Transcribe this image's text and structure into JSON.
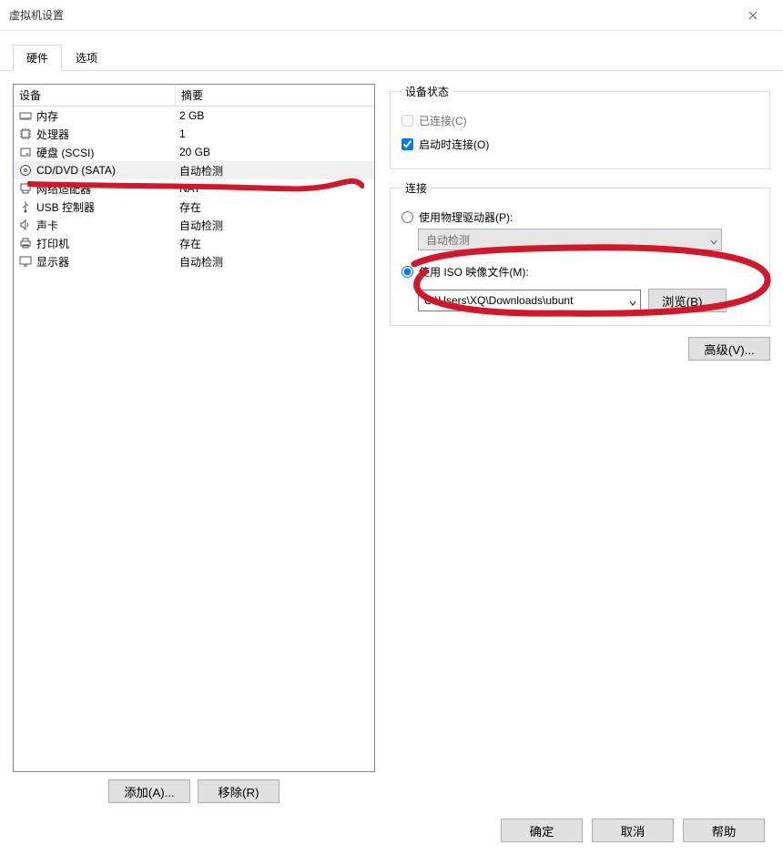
{
  "window": {
    "title": "虚拟机设置"
  },
  "tabs": {
    "hardware": "硬件",
    "options": "选项"
  },
  "device_list": {
    "headers": {
      "device": "设备",
      "summary": "摘要"
    },
    "items": [
      {
        "name": "内存",
        "summary": "2 GB",
        "icon": "memory"
      },
      {
        "name": "处理器",
        "summary": "1",
        "icon": "cpu"
      },
      {
        "name": "硬盘 (SCSI)",
        "summary": "20 GB",
        "icon": "disk"
      },
      {
        "name": "CD/DVD (SATA)",
        "summary": "自动检测",
        "icon": "cd",
        "selected": true
      },
      {
        "name": "网络适配器",
        "summary": "NAT",
        "icon": "net"
      },
      {
        "name": "USB 控制器",
        "summary": "存在",
        "icon": "usb"
      },
      {
        "name": "声卡",
        "summary": "自动检测",
        "icon": "sound"
      },
      {
        "name": "打印机",
        "summary": "存在",
        "icon": "printer"
      },
      {
        "name": "显示器",
        "summary": "自动检测",
        "icon": "display"
      }
    ]
  },
  "list_buttons": {
    "add": "添加(A)...",
    "remove": "移除(R)"
  },
  "status": {
    "legend": "设备状态",
    "connected": "已连接(C)",
    "connect_at_power_on": "启动时连接(O)"
  },
  "connection": {
    "legend": "连接",
    "use_physical": "使用物理驱动器(P):",
    "physical_value": "自动检测",
    "use_iso": "使用 ISO 映像文件(M):",
    "iso_value": "C:\\Users\\XQ\\Downloads\\ubunt",
    "browse": "浏览(B)..."
  },
  "advanced": "高级(V)...",
  "dialog_buttons": {
    "ok": "确定",
    "cancel": "取消",
    "help": "帮助"
  }
}
